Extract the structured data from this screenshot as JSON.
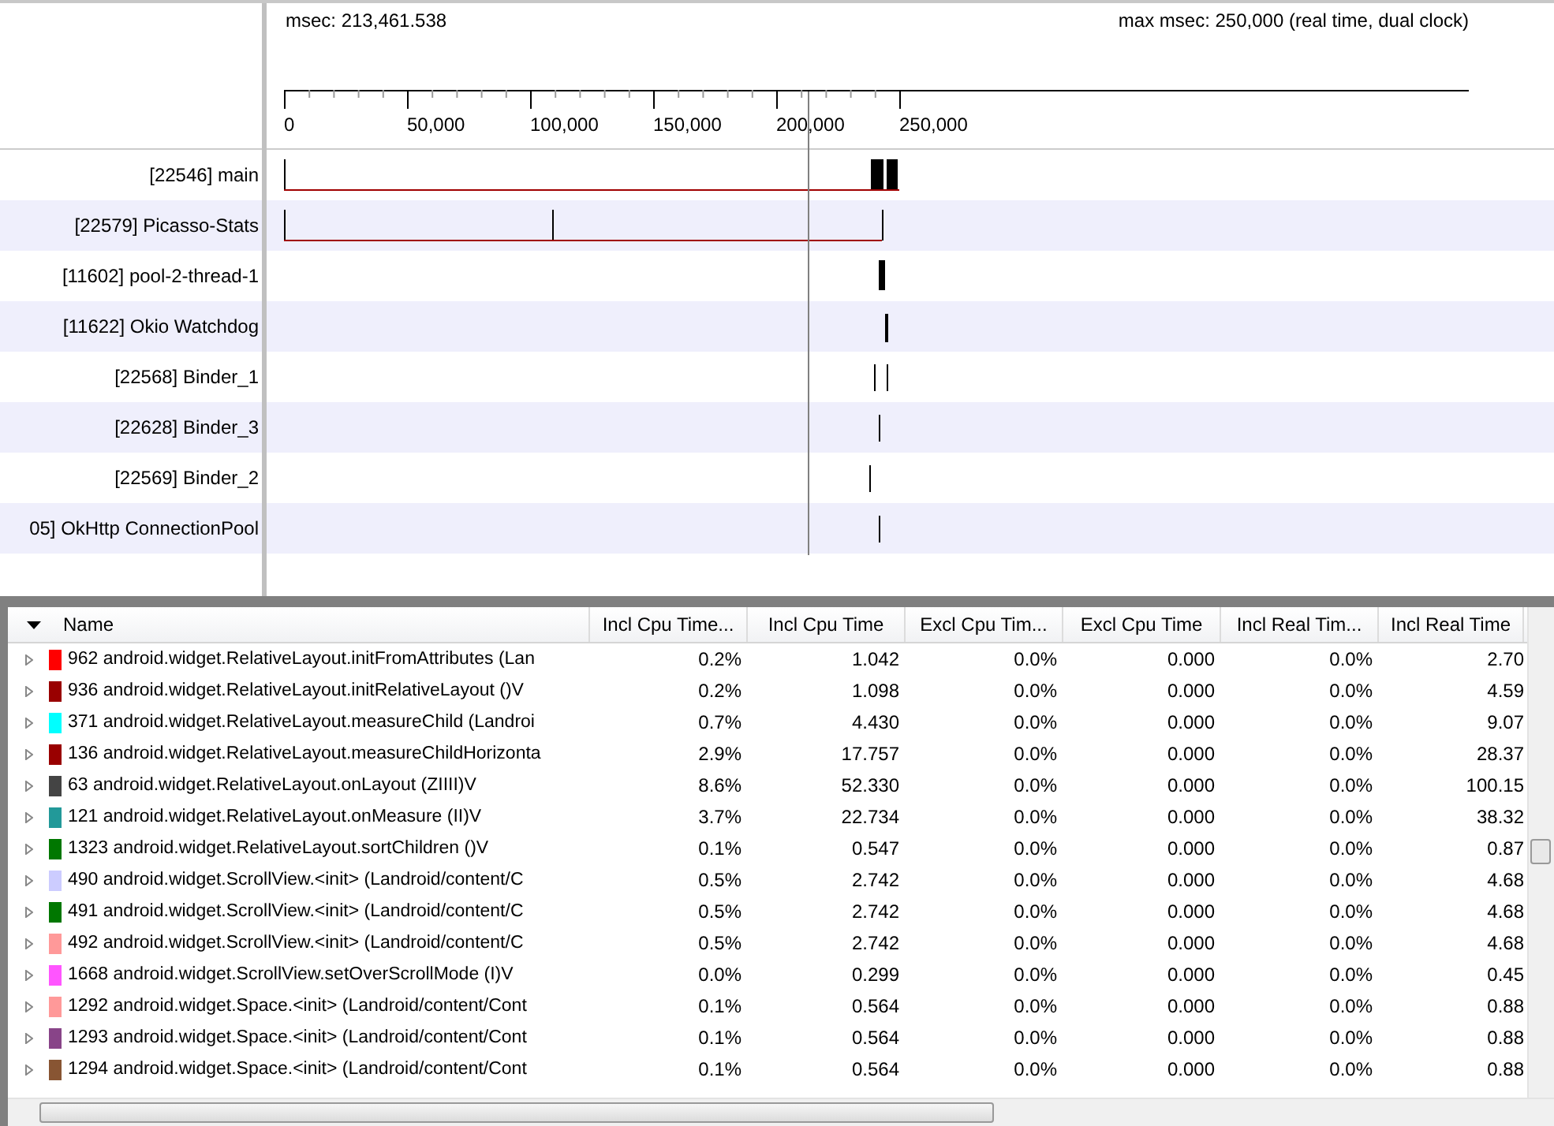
{
  "timeline": {
    "cursor_reading": "msec: 213,461.538",
    "max_reading": "max msec: 250,000 (real time, dual clock)",
    "axis_labels": [
      "0",
      "50,000",
      "100,000",
      "150,000",
      "200,000",
      "250,000"
    ],
    "threads": [
      {
        "name": "[22546] main"
      },
      {
        "name": "[22579] Picasso-Stats"
      },
      {
        "name": "[11602] pool-2-thread-1"
      },
      {
        "name": "[11622] Okio Watchdog"
      },
      {
        "name": "[22568] Binder_1"
      },
      {
        "name": "[22628] Binder_3"
      },
      {
        "name": "[22569] Binder_2"
      },
      {
        "name": "05] OkHttp ConnectionPool"
      }
    ]
  },
  "table": {
    "columns": [
      {
        "label": "Name",
        "sorted": true
      },
      {
        "label": "Incl Cpu Time...",
        "sorted": false
      },
      {
        "label": "Incl Cpu Time",
        "sorted": false
      },
      {
        "label": "Excl Cpu Tim...",
        "sorted": false
      },
      {
        "label": "Excl Cpu Time",
        "sorted": false
      },
      {
        "label": "Incl Real Tim...",
        "sorted": false
      },
      {
        "label": "Incl Real Time",
        "sorted": false
      }
    ],
    "rows": [
      {
        "expanded": false,
        "color": "#ff0000",
        "cells": [
          "962 android.widget.RelativeLayout.initFromAttributes (Lan",
          "0.2%",
          "1.042",
          "0.0%",
          "0.000",
          "0.0%",
          "2.70"
        ]
      },
      {
        "expanded": false,
        "color": "#990000",
        "cells": [
          "936 android.widget.RelativeLayout.initRelativeLayout ()V",
          "0.2%",
          "1.098",
          "0.0%",
          "0.000",
          "0.0%",
          "4.59"
        ]
      },
      {
        "expanded": false,
        "color": "#00ffff",
        "cells": [
          "371 android.widget.RelativeLayout.measureChild (Landroi",
          "0.7%",
          "4.430",
          "0.0%",
          "0.000",
          "0.0%",
          "9.07"
        ]
      },
      {
        "expanded": false,
        "color": "#990000",
        "cells": [
          "136 android.widget.RelativeLayout.measureChildHorizonta",
          "2.9%",
          "17.757",
          "0.0%",
          "0.000",
          "0.0%",
          "28.37"
        ]
      },
      {
        "expanded": false,
        "color": "#444444",
        "cells": [
          "63 android.widget.RelativeLayout.onLayout (ZIIII)V",
          "8.6%",
          "52.330",
          "0.0%",
          "0.000",
          "0.0%",
          "100.15"
        ]
      },
      {
        "expanded": false,
        "color": "#229999",
        "cells": [
          "121 android.widget.RelativeLayout.onMeasure (II)V",
          "3.7%",
          "22.734",
          "0.0%",
          "0.000",
          "0.0%",
          "38.32"
        ]
      },
      {
        "expanded": false,
        "color": "#007700",
        "cells": [
          "1323 android.widget.RelativeLayout.sortChildren ()V",
          "0.1%",
          "0.547",
          "0.0%",
          "0.000",
          "0.0%",
          "0.87"
        ]
      },
      {
        "expanded": false,
        "color": "#ccccff",
        "cells": [
          "490 android.widget.ScrollView.<init> (Landroid/content/C",
          "0.5%",
          "2.742",
          "0.0%",
          "0.000",
          "0.0%",
          "4.68"
        ]
      },
      {
        "expanded": false,
        "color": "#007700",
        "cells": [
          "491 android.widget.ScrollView.<init> (Landroid/content/C",
          "0.5%",
          "2.742",
          "0.0%",
          "0.000",
          "0.0%",
          "4.68"
        ]
      },
      {
        "expanded": false,
        "color": "#ff9999",
        "cells": [
          "492 android.widget.ScrollView.<init> (Landroid/content/C",
          "0.5%",
          "2.742",
          "0.0%",
          "0.000",
          "0.0%",
          "4.68"
        ]
      },
      {
        "expanded": false,
        "color": "#ff55ff",
        "cells": [
          "1668 android.widget.ScrollView.setOverScrollMode (I)V",
          "0.0%",
          "0.299",
          "0.0%",
          "0.000",
          "0.0%",
          "0.45"
        ]
      },
      {
        "expanded": false,
        "color": "#ff9999",
        "cells": [
          "1292 android.widget.Space.<init> (Landroid/content/Cont",
          "0.1%",
          "0.564",
          "0.0%",
          "0.000",
          "0.0%",
          "0.88"
        ]
      },
      {
        "expanded": false,
        "color": "#884488",
        "cells": [
          "1293 android.widget.Space.<init> (Landroid/content/Cont",
          "0.1%",
          "0.564",
          "0.0%",
          "0.000",
          "0.0%",
          "0.88"
        ]
      },
      {
        "expanded": false,
        "color": "#885533",
        "cells": [
          "1294 android.widget.Space.<init> (Landroid/content/Cont",
          "0.1%",
          "0.564",
          "0.0%",
          "0.000",
          "0.0%",
          "0.88"
        ]
      }
    ]
  }
}
